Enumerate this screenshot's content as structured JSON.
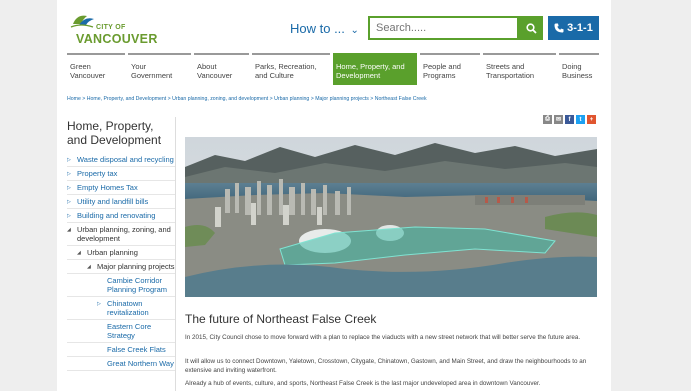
{
  "header": {
    "logo_small": "CITY OF",
    "logo_big": "VANCOUVER",
    "howto_label": "How to ...",
    "search_placeholder": "Search.....",
    "call_label": "3-1-1"
  },
  "nav": [
    {
      "label": "Green Vancouver",
      "active": false
    },
    {
      "label": "Your Government",
      "active": false
    },
    {
      "label": "About Vancouver",
      "active": false
    },
    {
      "label": "Parks, Recreation, and Culture",
      "active": false
    },
    {
      "label": "Home, Property, and Development",
      "active": true
    },
    {
      "label": "People and Programs",
      "active": false
    },
    {
      "label": "Streets and Transportation",
      "active": false
    },
    {
      "label": "Doing Business",
      "active": false
    }
  ],
  "breadcrumb": "Home > Home, Property, and Development > Urban planning, zoning, and development > Urban planning > Major planning projects > Northeast False Creek",
  "sidebar": {
    "title": "Home, Property, and Development",
    "items": [
      {
        "label": "Waste disposal and recycling"
      },
      {
        "label": "Property tax"
      },
      {
        "label": "Empty Homes Tax"
      },
      {
        "label": "Utility and landfill bills"
      },
      {
        "label": "Building and renovating"
      },
      {
        "label": "Urban planning, zoning, and development"
      },
      {
        "label": "Urban planning"
      },
      {
        "label": "Major planning projects"
      },
      {
        "label": "Cambie Corridor Planning Program"
      },
      {
        "label": "Chinatown revitalization"
      },
      {
        "label": "Eastern Core Strategy"
      },
      {
        "label": "False Creek Flats"
      },
      {
        "label": "Great Northern Way"
      }
    ]
  },
  "share_icons": [
    "print-icon",
    "email-icon",
    "facebook-icon",
    "twitter-icon",
    "add-icon"
  ],
  "article": {
    "title": "The future of Northeast False Creek",
    "p1": "In 2015, City Council chose to move forward with a plan to replace the viaducts with a new street network that will better serve the future area.",
    "p2": "It will allow us to connect Downtown, Yaletown, Crosstown, Citygate, Chinatown, Gastown, and Main Street, and draw the neighbourhoods to an extensive and inviting waterfront.",
    "p3": "Already a hub of events, culture, and sports, Northeast False Creek is the last major undeveloped area in downtown Vancouver."
  },
  "colors": {
    "brand_green": "#5aa02c",
    "brand_blue": "#1a6aa8"
  }
}
